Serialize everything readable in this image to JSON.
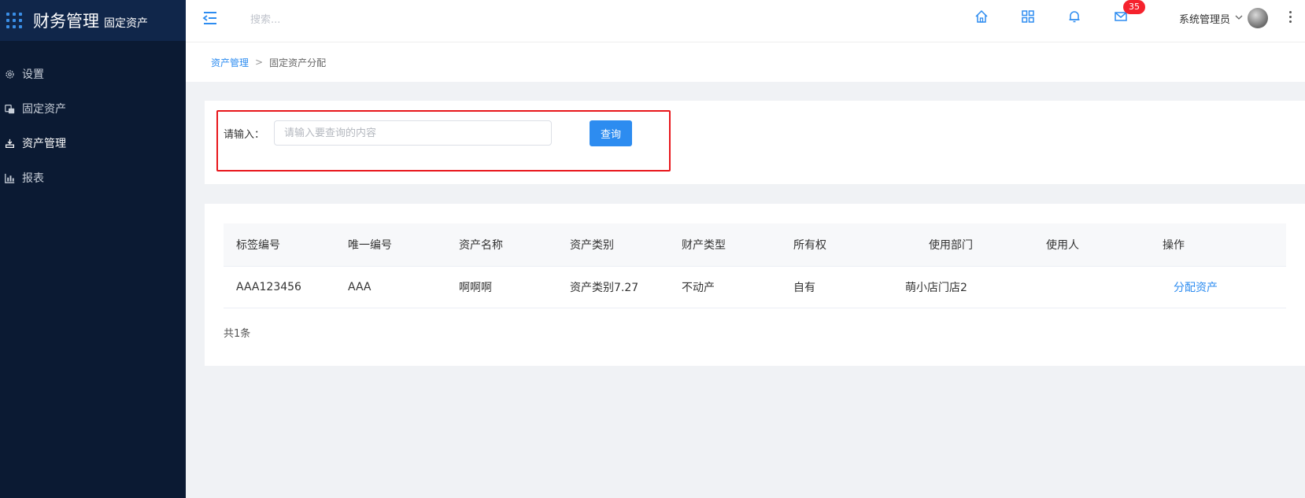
{
  "brand": {
    "title": "财务管理",
    "subtitle": "固定资产"
  },
  "sidebar": {
    "items": [
      {
        "label": "设置",
        "icon": "gear-icon"
      },
      {
        "label": "固定资产",
        "icon": "assets-icon"
      },
      {
        "label": "资产管理",
        "icon": "asset-manage-icon",
        "active": true
      },
      {
        "label": "报表",
        "icon": "bar-chart-icon"
      }
    ]
  },
  "header": {
    "search_placeholder": "搜索...",
    "mail_badge": "35",
    "user_name": "系统管理员"
  },
  "breadcrumb": {
    "parent": "资产管理",
    "separator": ">",
    "current": "固定资产分配"
  },
  "query": {
    "label": "请输入：",
    "placeholder": "请输入要查询的内容",
    "value": "",
    "button": "查询"
  },
  "table": {
    "columns": [
      "标签编号",
      "唯一编号",
      "资产名称",
      "资产类别",
      "财产类型",
      "所有权",
      "使用部门",
      "使用人",
      "操作"
    ],
    "rows": [
      {
        "tag_no": "AAA123456",
        "unique_no": "AAA",
        "asset_name": "啊啊啊",
        "asset_category": "资产类别7.27",
        "property_type": "不动产",
        "ownership": "自有",
        "department": "萌小店门店2",
        "user": "",
        "action": "分配资产"
      }
    ],
    "total": "共1条"
  },
  "colors": {
    "sidebar_bg": "#0b1a33",
    "accent": "#2d8cf0",
    "highlight": "#e8161b",
    "badge": "#f5222d"
  }
}
